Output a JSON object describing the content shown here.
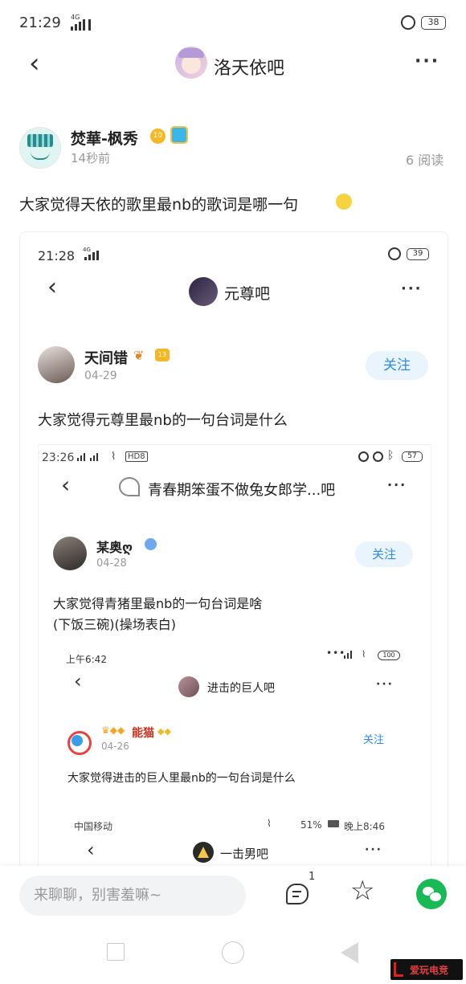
{
  "status": {
    "time": "21:29",
    "net": "4G",
    "battery": "38"
  },
  "header": {
    "title": "洛天依吧"
  },
  "post": {
    "author": "焚華-枫秀",
    "time": "14秒前",
    "views": "6 阅读",
    "level_badge": "10",
    "text": "大家觉得天依的歌里最nb的歌词是哪一句"
  },
  "shot1": {
    "time": "21:28",
    "net": "4G",
    "battery": "39",
    "title": "元尊吧",
    "author": "天间错",
    "level_badge": "13",
    "date": "04-29",
    "follow": "关注",
    "text": "大家觉得元尊里最nb的一句台词是什么"
  },
  "shot2": {
    "time": "23:26",
    "net": "HD8",
    "battery": "57",
    "title": "青春期笨蛋不做兔女郎学...吧",
    "author": "某奥ღ",
    "date": "04-28",
    "follow": "关注",
    "text_line1": "大家觉得青猪里最nb的一句台词是啥",
    "text_line2": "(下饭三碗)(操场表白)"
  },
  "shot3": {
    "time": "上午6:42",
    "battery": "100",
    "title": "进击的巨人吧",
    "author": "能猫",
    "date": "04-26",
    "follow": "关注",
    "text": "大家觉得进击的巨人里最nb的一句台词是什么"
  },
  "shot4": {
    "carrier": "中国移动",
    "battery": "51%",
    "time": "晚上8:46",
    "title": "一击男吧"
  },
  "bottom": {
    "placeholder": "来聊聊，别害羞嘛~",
    "comment_count": "1"
  },
  "watermark": "爱玩电竞",
  "colors": {
    "accent": "#2e8be0",
    "wechat": "#19b955",
    "follow_bg": "#eaf4fd"
  }
}
